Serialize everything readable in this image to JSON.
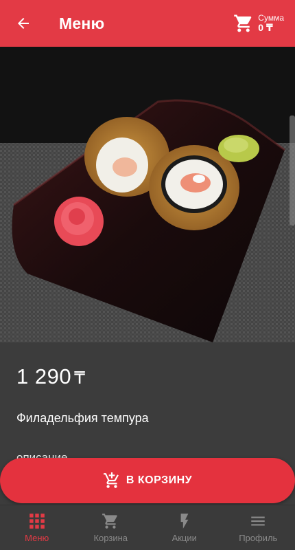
{
  "header": {
    "title": "Меню",
    "sum_label": "Сумма",
    "sum_value": "0 ₸"
  },
  "product": {
    "price": "1 290",
    "currency": "₸",
    "name": "Филадельфия темпура",
    "description_label": "описание",
    "image_description": "photo of philadelphia tempura roll pieces on a dark plate with pickled ginger rose and wasabi"
  },
  "actions": {
    "add_to_cart": "В КОРЗИНУ"
  },
  "nav": {
    "items": [
      {
        "label": "Меню",
        "icon": "grid-icon",
        "active": true
      },
      {
        "label": "Корзина",
        "icon": "cart-icon",
        "active": false
      },
      {
        "label": "Акции",
        "icon": "lightning-icon",
        "active": false
      },
      {
        "label": "Профиль",
        "icon": "menu-icon",
        "active": false
      }
    ]
  },
  "colors": {
    "accent": "#e33a45",
    "background": "#3c3c3c",
    "nav_inactive": "#8a8a8a"
  }
}
